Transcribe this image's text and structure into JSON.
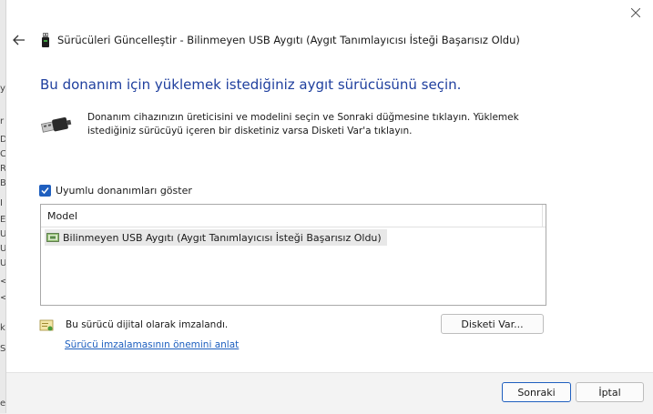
{
  "background_window": {
    "fragments": [
      "y",
      "r",
      "D",
      "C",
      "R",
      "B",
      "I",
      "E",
      "U",
      "U",
      "U",
      "<",
      "<",
      "k",
      "S",
      "e"
    ]
  },
  "dialog": {
    "title": "Sürücüleri Güncelleştir - Bilinmeyen USB Aygıtı (Aygıt Tanımlayıcısı İsteği Başarısız Oldu)",
    "heading": "Bu donanım için yüklemek istediğiniz aygıt sürücüsünü seçin.",
    "description": "Donanım cihazınızın üreticisini ve modelini seçin ve Sonraki düğmesine tıklayın. Yüklemek istediğiniz sürücüyü içeren bir disketiniz varsa Disketi Var'a tıklayın.",
    "compatible_checkbox": {
      "label": "Uyumlu donanımları göster",
      "checked": true
    },
    "model_list": {
      "header": "Model",
      "items": [
        {
          "label": "Bilinmeyen USB Aygıtı (Aygıt Tanımlayıcısı İsteği Başarısız Oldu)",
          "selected": true
        }
      ]
    },
    "signature_text": "Bu sürücü dijital olarak imzalandı.",
    "signature_link": "Sürücü imzalamasının önemini anlat",
    "have_disk_label": "Disketi Var...",
    "next_label": "Sonraki",
    "cancel_label": "İptal"
  },
  "icons": {
    "close": "close-icon",
    "back": "back-arrow-icon",
    "title_device": "usb-device-icon",
    "usb": "usb-plug-icon",
    "model_item": "device-board-icon",
    "signature": "certificate-icon"
  },
  "colors": {
    "accent": "#1f5fbf",
    "heading": "#1f3f9e",
    "link": "#1d5fbf"
  }
}
